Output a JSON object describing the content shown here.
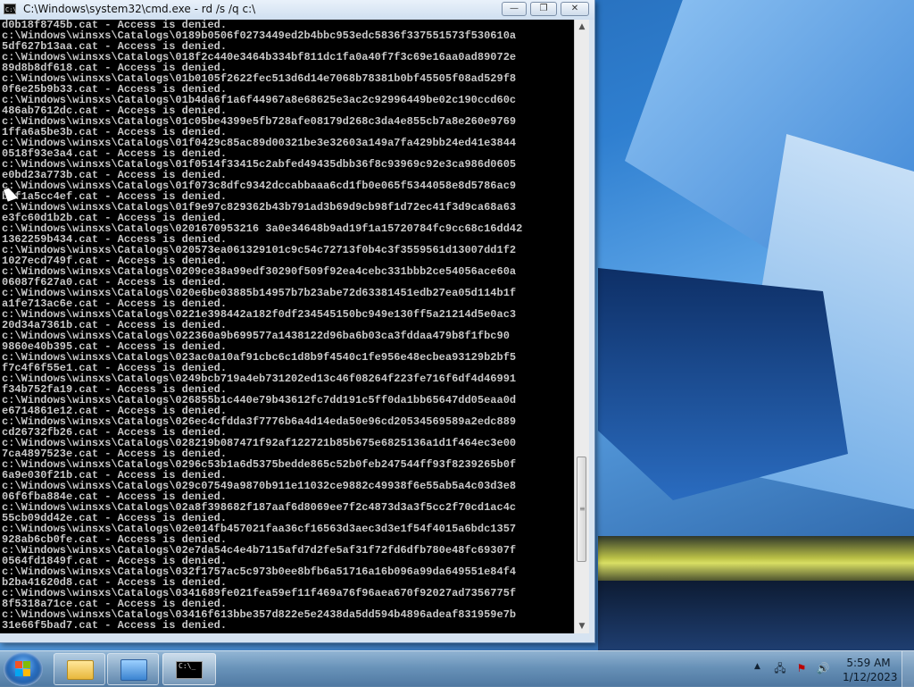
{
  "window": {
    "title": "C:\\Windows\\system32\\cmd.exe - rd  /s /q c:\\",
    "icon": "C:\\",
    "min": "—",
    "max": "❐",
    "close": "✕"
  },
  "console_lines": [
    "d0b18f8745b.cat - Access is denied.",
    "c:\\Windows\\winsxs\\Catalogs\\0189b0506f0273449ed2b4bbc953edc5836f337551573f530610a",
    "5df627b13aa.cat - Access is denied.",
    "c:\\Windows\\winsxs\\Catalogs\\018f2c440e3464b334bf811dc1fa0a40f7f3c69e16aa0ad89072e",
    "89d8b8df618.cat - Access is denied.",
    "c:\\Windows\\winsxs\\Catalogs\\01b0105f2622fec513d6d14e7068b78381b0bf45505f08ad529f8",
    "0f6e25b9b33.cat - Access is denied.",
    "c:\\Windows\\winsxs\\Catalogs\\01b4da6f1a6f44967a8e68625e3ac2c92996449be02c190ccd60c",
    "486ab7612dc.cat - Access is denied.",
    "c:\\Windows\\winsxs\\Catalogs\\01c05be4399e5fb728afe08179d268c3da4e855cb7a8e260e9769",
    "1ffa6a5be3b.cat - Access is denied.",
    "c:\\Windows\\winsxs\\Catalogs\\01f0429c85ac89d00321be3e32603a149a7fa429bb24ed41e3844",
    "0518f93e3a4.cat - Access is denied.",
    "c:\\Windows\\winsxs\\Catalogs\\01f0514f33415c2abfed49435dbb36f8c93969c92e3ca986d0605",
    "e0bd23a773b.cat - Access is denied.",
    "c:\\Windows\\winsxs\\Catalogs\\01f073c8dfc9342dccabbaaa6cd1fb0e065f5344058e8d5786ac9",
    "b6f1a5cc4ef.cat - Access is denied.",
    "c:\\Windows\\winsxs\\Catalogs\\01f9e97c829362b43b791ad3b69d9cb98f1d72ec41f3d9ca68a63",
    "e3fc60d1b2b.cat - Access is denied.",
    "c:\\Windows\\winsxs\\Catalogs\\0201670953216 3a0e34648b9ad19f1a15720784fc9cc68c16dd42",
    "1362259b434.cat - Access is denied.",
    "c:\\Windows\\winsxs\\Catalogs\\020573ea061329101c9c54c72713f0b4c3f3559561d13007dd1f2",
    "1027ecd749f.cat - Access is denied.",
    "c:\\Windows\\winsxs\\Catalogs\\0209ce38a99edf30290f509f92ea4cebc331bbb2ce54056ace60a",
    "06087f627a0.cat - Access is denied.",
    "c:\\Windows\\winsxs\\Catalogs\\020e6be03885b14957b7b23abe72d63381451edb27ea05d114b1f",
    "a1fe713ac6e.cat - Access is denied.",
    "c:\\Windows\\winsxs\\Catalogs\\0221e398442a182f0df234545150bc949e130ff5a21214d5e0ac3",
    "20d34a7361b.cat - Access is denied.",
    "c:\\Windows\\winsxs\\Catalogs\\022360a9b699577a1438122d96ba6b03ca3fddaa479b8f1fbc90",
    "9860e40b395.cat - Access is denied.",
    "c:\\Windows\\winsxs\\Catalogs\\023ac0a10af91cbc6c1d8b9f4540c1fe956e48ecbea93129b2bf5",
    "f7c4f6f55e1.cat - Access is denied.",
    "c:\\Windows\\winsxs\\Catalogs\\0249bcb719a4eb731202ed13c46f08264f223fe716f6df4d46991",
    "f34b752fa19.cat - Access is denied.",
    "c:\\Windows\\winsxs\\Catalogs\\026855b1c440e79b43612fc7dd191c5ff0da1bb65647dd05eaa0d",
    "e6714861e12.cat - Access is denied.",
    "c:\\Windows\\winsxs\\Catalogs\\026ec4cfdda3f7776b6a4d14eda50e96cd20534569589a2edc889",
    "cd26732fb26.cat - Access is denied.",
    "c:\\Windows\\winsxs\\Catalogs\\028219b087471f92af122721b85b675e6825136a1d1f464ec3e00",
    "7ca4897523e.cat - Access is denied.",
    "c:\\Windows\\winsxs\\Catalogs\\0296c53b1a6d5375bedde865c52b0feb247544ff93f8239265b0f",
    "6a9e030f21b.cat - Access is denied.",
    "c:\\Windows\\winsxs\\Catalogs\\029c07549a9870b911e11032ce9882c49938f6e55ab5a4c03d3e8",
    "06f6fba884e.cat - Access is denied.",
    "c:\\Windows\\winsxs\\Catalogs\\02a8f398682f187aaf6d8069ee7f2c4873d3a3f5cc2f70cd1ac4c",
    "55cb09dd42e.cat - Access is denied.",
    "c:\\Windows\\winsxs\\Catalogs\\02e014fb457021faa36cf16563d3aec3d3e1f54f4015a6bdc1357",
    "928ab6cb0fe.cat - Access is denied.",
    "c:\\Windows\\winsxs\\Catalogs\\02e7da54c4e4b7115afd7d2fe5af31f72fd6dfb780e48fc69307f",
    "0564fd1849f.cat - Access is denied.",
    "c:\\Windows\\winsxs\\Catalogs\\032f1757ac5c973b0ee8bfb6a51716a16b096a99da649551e84f4",
    "b2ba41620d8.cat - Access is denied.",
    "c:\\Windows\\winsxs\\Catalogs\\0341689fe021fea59ef11f469a76f96aea670f92027ad7356775f",
    "8f5318a71ce.cat - Access is denied.",
    "c:\\Windows\\winsxs\\Catalogs\\03416f613bbe357d822e5e2438da5dd594b4896adeaf831959e7b",
    "31e66f5bad7.cat - Access is denied."
  ],
  "scrollbar": {
    "up": "▲",
    "down": "▼",
    "grip": "≡",
    "position_fraction": 0.88
  },
  "taskbar": {
    "cmd_icon_text": "C:\\_",
    "tray_up": "▲",
    "network_icon": "🖧",
    "flag_icon": "⚑",
    "volume_icon": "🔊",
    "time": "5:59 AM",
    "date": "1/12/2023"
  }
}
